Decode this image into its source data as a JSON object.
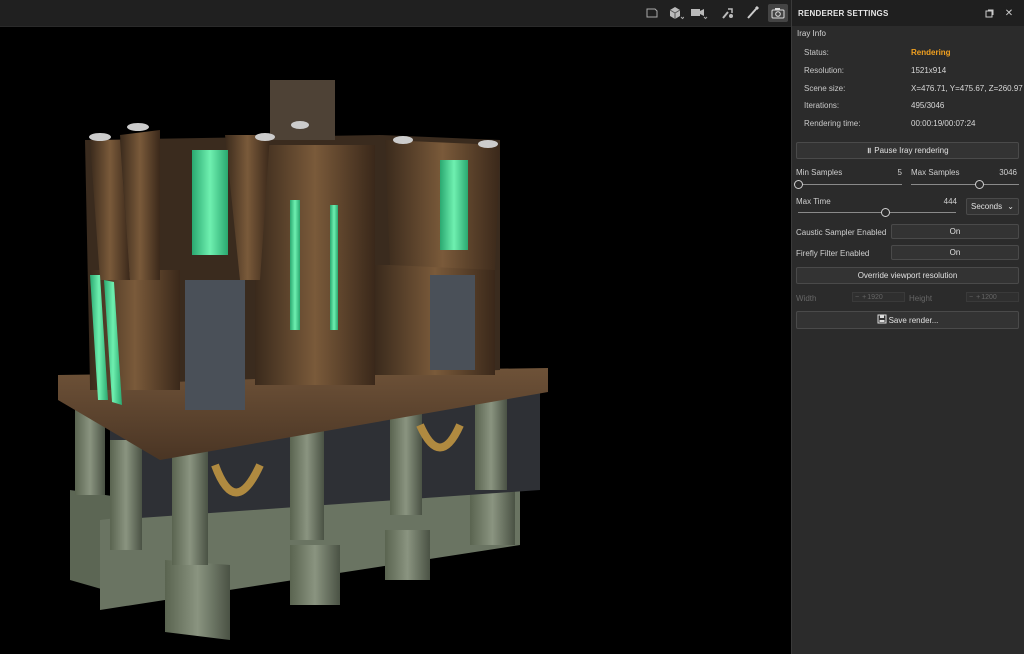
{
  "panel": {
    "title": "RENDERER SETTINGS",
    "section": "Iray Info",
    "info": [
      {
        "label": "Status:",
        "value": "Rendering"
      },
      {
        "label": "Resolution:",
        "value": "1521x914"
      },
      {
        "label": "Scene size:",
        "value": "X=476.71, Y=475.67, Z=260.97"
      },
      {
        "label": "Iterations:",
        "value": "495/3046"
      },
      {
        "label": "Rendering time:",
        "value": "00:00:19/00:07:24"
      }
    ],
    "pause_label": "Pause Iray rendering",
    "min_samples": {
      "label": "Min Samples",
      "value": "5",
      "fraction": 0.0
    },
    "max_samples": {
      "label": "Max Samples",
      "value": "3046",
      "fraction": 0.63
    },
    "max_time": {
      "label": "Max Time",
      "value": "444",
      "fraction": 0.55
    },
    "time_unit": "Seconds",
    "caustic": {
      "label": "Caustic Sampler Enabled",
      "value": "On"
    },
    "firefly": {
      "label": "Firefly Filter Enabled",
      "value": "On"
    },
    "override_label": "Override viewport resolution",
    "width": {
      "label": "Width",
      "value": "1920"
    },
    "height": {
      "label": "Height",
      "value": "1200"
    },
    "save_label": "Save render...",
    "status_color": "#f0a020"
  },
  "toolbar": {
    "icons": [
      "frame-icon",
      "cube-icon",
      "camera-icon",
      "tools-icon",
      "brush-icon",
      "render-camera-icon"
    ]
  }
}
